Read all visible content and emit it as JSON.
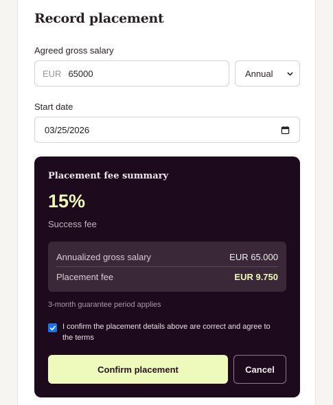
{
  "form": {
    "title": "Record placement",
    "salary_label": "Agreed gross salary",
    "currency_prefix": "EUR",
    "salary_value": "65000",
    "period_selected": "Annual",
    "start_label": "Start date",
    "start_value": "03/25/2026"
  },
  "summary": {
    "title": "Placement fee summary",
    "percent": "15%",
    "fee_type": "Success fee",
    "rows": [
      {
        "label": "Annualized gross salary",
        "value": "EUR 65.000"
      },
      {
        "label": "Placement fee",
        "value": "EUR 9.750"
      }
    ],
    "guarantee": "3-month guarantee period applies",
    "confirm_text": "I confirm the placement details above are correct and agree to the terms",
    "confirm_checked": true
  },
  "actions": {
    "confirm_label": "Confirm placement",
    "cancel_label": "Cancel"
  },
  "colors": {
    "panel_bg": "#1d0a1d",
    "accent": "#eefabb",
    "checkbox": "#1a73e8"
  },
  "icons": {
    "period_select": "chevron-down-icon",
    "date_picker": "calendar-icon",
    "confirm_checkbox": "check-icon"
  }
}
